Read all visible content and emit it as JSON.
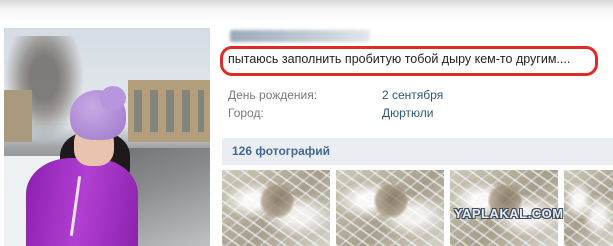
{
  "profile": {
    "status": "пытаюсь заполнить пробитую тобой дыру кем-то другим....",
    "info": [
      {
        "label": "День рождения:",
        "value": "2 сентября"
      },
      {
        "label": "Город:",
        "value": "Дюртюли"
      }
    ]
  },
  "photos": {
    "header": "126 фотографий",
    "thumbnails": [
      "frost-photo-1",
      "frost-photo-2",
      "frost-photo-3",
      "frost-photo-4"
    ]
  },
  "watermark": {
    "text": "YAPLAKAL.COM"
  },
  "colors": {
    "highlight_border": "#e12a25",
    "link": "#2b587a",
    "label": "#7a7a7a",
    "section_header_bg": "#eaeef2",
    "section_header_text": "#45688e"
  }
}
